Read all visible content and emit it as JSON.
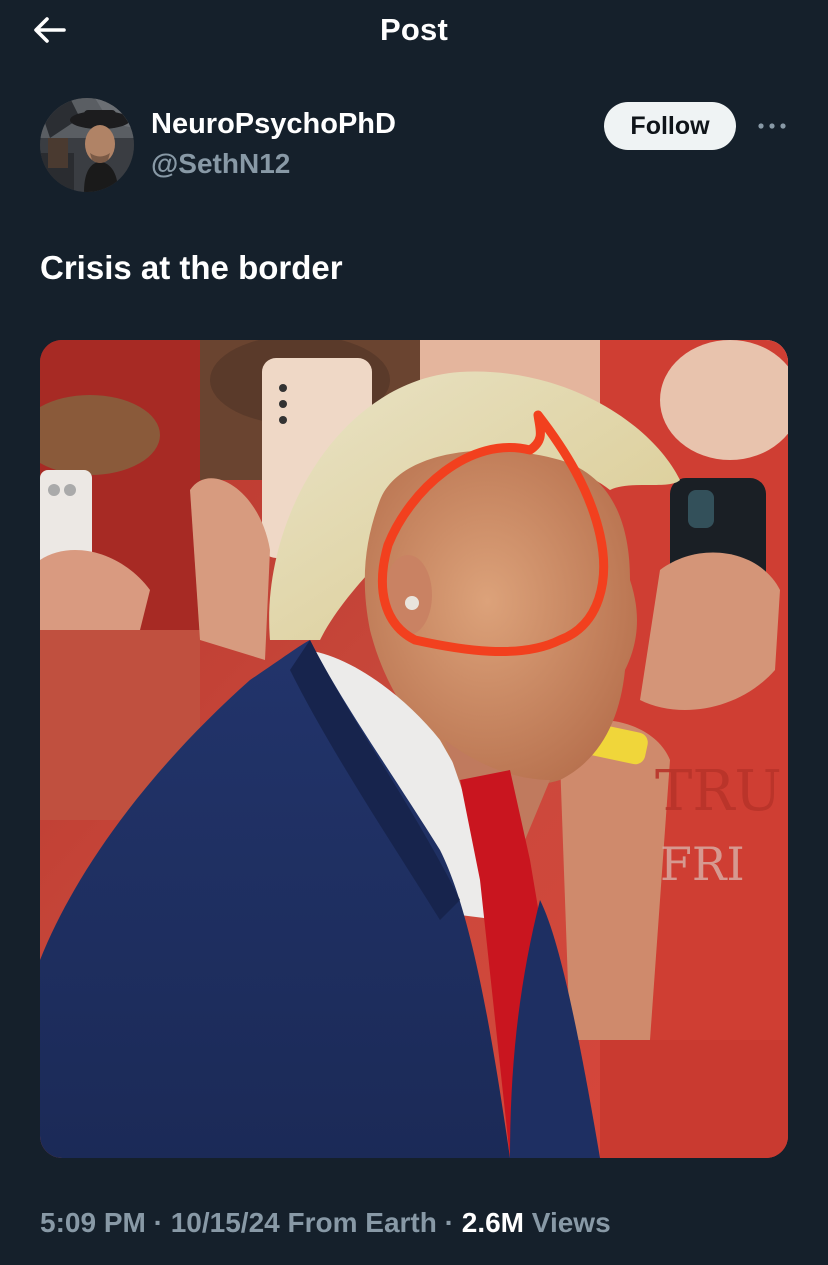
{
  "header": {
    "title": "Post",
    "back_icon": "arrow-left-icon"
  },
  "author": {
    "display_name": "NeuroPsychoPhD",
    "handle": "@SethN12",
    "avatar_icon": "avatar"
  },
  "actions": {
    "follow_label": "Follow",
    "more_icon": "more-horizontal-icon"
  },
  "post": {
    "text": "Crisis at the border",
    "media_description_icon": "photo"
  },
  "meta": {
    "time": "5:09 PM",
    "separator": "·",
    "date": "10/15/24",
    "source": "From Earth",
    "views_count": "2.6M",
    "views_label": "Views"
  },
  "colors": {
    "background": "#15202b",
    "text_primary": "#ffffff",
    "text_secondary": "#8899a6",
    "follow_bg": "#eff3f4",
    "annotation_red": "#f2401e"
  }
}
